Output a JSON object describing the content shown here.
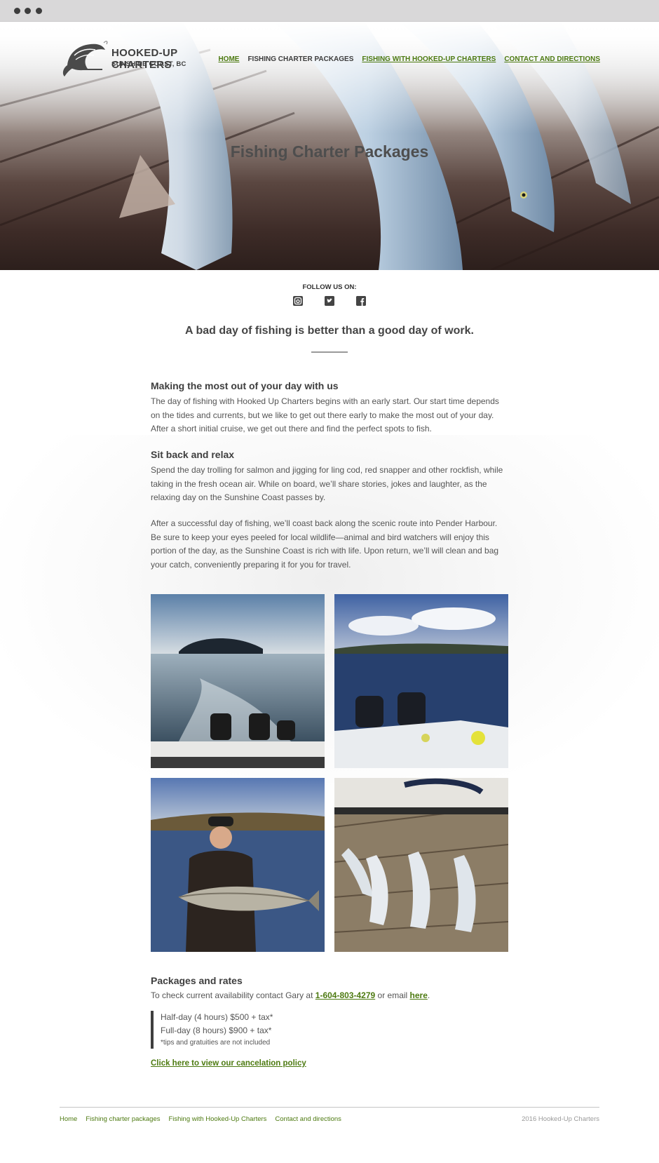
{
  "colors": {
    "link_green": "#4d7a11",
    "text": "#555555",
    "heading": "#3e3e3e"
  },
  "site": {
    "name": "HOOKED-UP CHARTERS",
    "location": "SUNSHINE COAST, BC",
    "logo_icon": "leaping-salmon-icon"
  },
  "nav": {
    "items": [
      {
        "label": "HOME",
        "current": false
      },
      {
        "label": "FISHING CHARTER PACKAGES",
        "current": true
      },
      {
        "label": "FISHING WITH HOOKED-UP CHARTERS",
        "current": false
      },
      {
        "label": "CONTACT AND DIRECTIONS",
        "current": false
      }
    ]
  },
  "hero": {
    "title": "Fishing Charter Packages"
  },
  "follow": {
    "label": "FOLLOW US ON:",
    "icons": [
      "instagram-icon",
      "twitter-icon",
      "facebook-icon"
    ]
  },
  "quote": "A bad day of fishing is better than a good day of work.",
  "sections": [
    {
      "heading": "Making the most out of your day with us",
      "body": "The day of fishing with Hooked Up Charters begins with an early start. Our start time depends on the tides and currents, but we like to get out there early to make the most out of your day. After a short initial cruise, we get out there and find the perfect spots to fish."
    },
    {
      "heading": "Sit back and relax",
      "body": "Spend the day trolling for salmon and jigging for ling cod, red snapper and other rockfish, while taking in the fresh ocean air. While on board, we’ll share stories, jokes and laughter, as the relaxing day on the Sunshine Coast passes by."
    },
    {
      "heading": "",
      "body": "After a successful day of fishing, we’ll coast back along the scenic route into Pender Harbour. Be sure to keep your eyes peeled for local wildlife—animal and bird watchers will enjoy this portion of the day, as the Sunshine Coast is rich with life. Upon return, we’ll will clean and bag your catch, conveniently preparing it for you for travel."
    }
  ],
  "packages": {
    "heading": "Packages and rates",
    "contact_prefix": "To check current availability contact Gary at ",
    "phone": "1-604-803-4279",
    "contact_middle": " or email ",
    "email_link": "here",
    "contact_suffix": ".",
    "rates": [
      "Half-day (4 hours) $500 + tax*",
      "Full-day (8 hours) $900 + tax*"
    ],
    "note": "*tips and gratuities are not included",
    "cancel_link": "Click here to view our cancelation policy"
  },
  "footer": {
    "links": [
      "Home",
      "Fishing charter packages",
      "Fishing with Hooked-Up Charters",
      "Contact and directions"
    ],
    "copyright": "2016 Hooked-Up Charters"
  }
}
